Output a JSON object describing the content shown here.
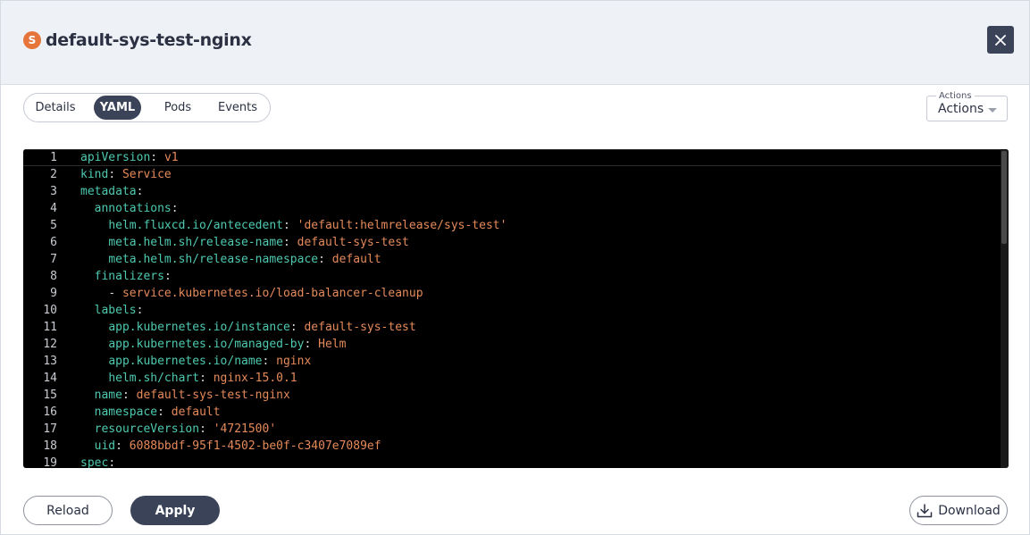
{
  "header": {
    "kind_badge": "S",
    "title": "default-sys-test-nginx",
    "close_icon": "close-icon"
  },
  "tabs": [
    {
      "label": "Details",
      "active": false
    },
    {
      "label": "YAML",
      "active": true
    },
    {
      "label": "Pods",
      "active": false
    },
    {
      "label": "Events",
      "active": false
    }
  ],
  "actions": {
    "legend": "Actions",
    "value": "Actions"
  },
  "editor": {
    "lines": [
      {
        "n": "1",
        "indent": "",
        "key": "apiVersion",
        "sep": ": ",
        "val": "v1"
      },
      {
        "n": "2",
        "indent": "",
        "key": "kind",
        "sep": ": ",
        "val": "Service"
      },
      {
        "n": "3",
        "indent": "",
        "key": "metadata",
        "sep": ":",
        "val": ""
      },
      {
        "n": "4",
        "indent": "  ",
        "key": "annotations",
        "sep": ":",
        "val": ""
      },
      {
        "n": "5",
        "indent": "    ",
        "key": "helm.fluxcd.io/antecedent",
        "sep": ": ",
        "val": "'default:helmrelease/sys-test'"
      },
      {
        "n": "6",
        "indent": "    ",
        "key": "meta.helm.sh/release-name",
        "sep": ": ",
        "val": "default-sys-test"
      },
      {
        "n": "7",
        "indent": "    ",
        "key": "meta.helm.sh/release-namespace",
        "sep": ": ",
        "val": "default"
      },
      {
        "n": "8",
        "indent": "  ",
        "key": "finalizers",
        "sep": ":",
        "val": ""
      },
      {
        "n": "9",
        "indent": "    ",
        "key": "",
        "sep": "- ",
        "val": "service.kubernetes.io/load-balancer-cleanup"
      },
      {
        "n": "10",
        "indent": "  ",
        "key": "labels",
        "sep": ":",
        "val": ""
      },
      {
        "n": "11",
        "indent": "    ",
        "key": "app.kubernetes.io/instance",
        "sep": ": ",
        "val": "default-sys-test"
      },
      {
        "n": "12",
        "indent": "    ",
        "key": "app.kubernetes.io/managed-by",
        "sep": ": ",
        "val": "Helm"
      },
      {
        "n": "13",
        "indent": "    ",
        "key": "app.kubernetes.io/name",
        "sep": ": ",
        "val": "nginx"
      },
      {
        "n": "14",
        "indent": "    ",
        "key": "helm.sh/chart",
        "sep": ": ",
        "val": "nginx-15.0.1"
      },
      {
        "n": "15",
        "indent": "  ",
        "key": "name",
        "sep": ": ",
        "val": "default-sys-test-nginx"
      },
      {
        "n": "16",
        "indent": "  ",
        "key": "namespace",
        "sep": ": ",
        "val": "default"
      },
      {
        "n": "17",
        "indent": "  ",
        "key": "resourceVersion",
        "sep": ": ",
        "val": "'4721500'"
      },
      {
        "n": "18",
        "indent": "  ",
        "key": "uid",
        "sep": ": ",
        "val": "6088bbdf-95f1-4502-be0f-c3407e7089ef"
      },
      {
        "n": "19",
        "indent": "",
        "key": "spec",
        "sep": ":",
        "val": ""
      }
    ]
  },
  "footer": {
    "reload_label": "Reload",
    "apply_label": "Apply",
    "download_label": "Download",
    "download_icon": "download-icon"
  },
  "colors": {
    "primary": "#3b4359",
    "badge": "#e5753b",
    "yaml_key": "#4ec9b0",
    "yaml_value": "#e58a5a"
  }
}
